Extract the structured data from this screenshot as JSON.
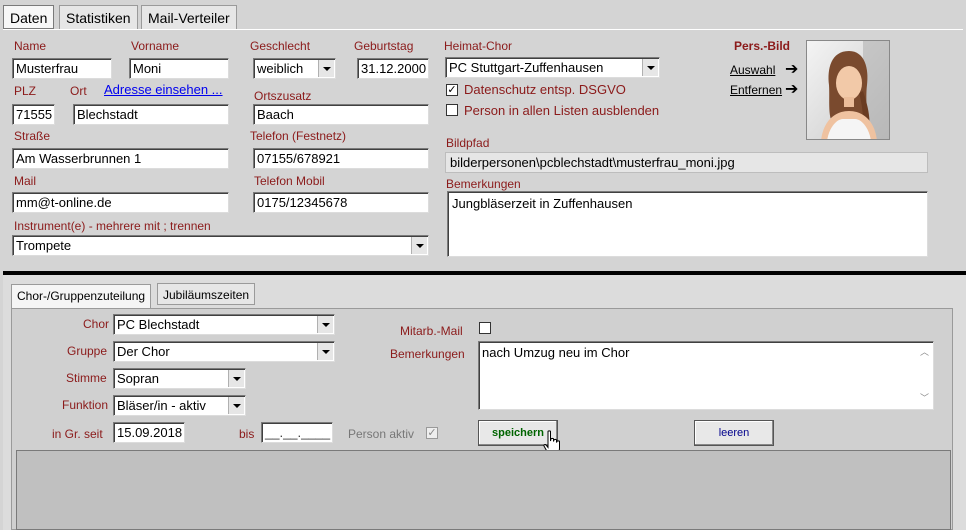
{
  "tabs": [
    "Daten",
    "Statistiken",
    "Mail-Verteiler"
  ],
  "person": {
    "name_label": "Name",
    "name": "Musterfrau",
    "vorname_label": "Vorname",
    "vorname": "Moni",
    "geschlecht_label": "Geschlecht",
    "geschlecht": "weiblich",
    "geburtstag_label": "Geburtstag",
    "geburtstag": "31.12.2000",
    "heimatchor_label": "Heimat-Chor",
    "heimatchor": "PC Stuttgart-Zuffenhausen",
    "datenschutz_label": "Datenschutz entsp. DSGVO",
    "datenschutz_checked": "✓",
    "ausblenden_label": "Person in allen Listen ausblenden",
    "plz_label": "PLZ",
    "plz": "71555",
    "ort_label": "Ort",
    "ort": "Blechstadt",
    "adresse_link": "Adresse einsehen ...",
    "ortszusatz_label": "Ortszusatz",
    "ortszusatz": "Baach",
    "strasse_label": "Straße",
    "strasse": "Am Wasserbrunnen 1",
    "telefon_label": "Telefon (Festnetz)",
    "telefon": "07155/678921",
    "bildpfad_label": "Bildpfad",
    "bildpfad": "bilderpersonen\\pcblechstadt\\musterfrau_moni.jpg",
    "mail_label": "Mail",
    "mail": "mm@t-online.de",
    "mobil_label": "Telefon Mobil",
    "mobil": "0175/12345678",
    "bemerkungen_label": "Bemerkungen",
    "bemerkungen": "Jungbläserzeit in Zuffenhausen",
    "instrument_label": "Instrument(e) - mehrere mit ; trennen",
    "instrument": "Trompete",
    "bild_title": "Pers.-Bild",
    "auswahl": "Auswahl",
    "entfernen": "Entfernen"
  },
  "subtabs": [
    "Chor-/Gruppenzuteilung",
    "Jubiläumszeiten"
  ],
  "group": {
    "chor_label": "Chor",
    "chor": "PC Blechstadt",
    "gruppe_label": "Gruppe",
    "gruppe": "Der Chor",
    "stimme_label": "Stimme",
    "stimme": "Sopran",
    "funktion_label": "Funktion",
    "funktion": "Bläser/in - aktiv",
    "seit_label": "in Gr. seit",
    "seit": "15.09.2018",
    "bis_label": "bis",
    "bis": "__.__.____",
    "aktiv_label": "Person aktiv",
    "aktiv_checked": "✓",
    "mitarb_label": "Mitarb.-Mail",
    "bemerkungen_label": "Bemerkungen",
    "bemerkungen": "nach Umzug neu im Chor",
    "save_button": "speichern",
    "clear_button": "leeren"
  },
  "colors": {
    "label": "#8b1a1a",
    "save_text": "#006400",
    "clear_text": "#00008b"
  }
}
